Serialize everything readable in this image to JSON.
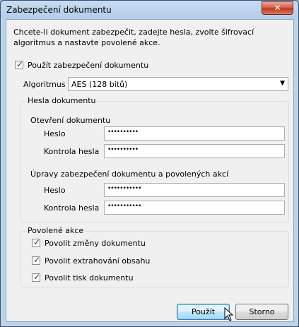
{
  "window": {
    "title": "Zabezpečení dokumentu",
    "close_glyph": "✕"
  },
  "description": "Chcete-li dokument zabezpečit, zadejte hesla, zvolte šifrovací algoritmus a nastavte povolené akce.",
  "use_security": {
    "label": "Použít zabezpečení dokumentu",
    "checked": true
  },
  "algorithm": {
    "label": "Algoritmus",
    "value": "AES (128 bitů)"
  },
  "passwords_group": {
    "title": "Hesla dokumentu",
    "open_section": {
      "title": "Otevření dokumentu",
      "password_label": "Heslo",
      "password_value": "••••••••••",
      "confirm_label": "Kontrola hesla",
      "confirm_value": "••••••••••"
    },
    "permissions_section": {
      "title": "Úpravy zabezpečení dokumentu a povolených akcí",
      "password_label": "Heslo",
      "password_value": "•••••••••••",
      "confirm_label": "Kontrola hesla",
      "confirm_value": "•••••••••••"
    }
  },
  "allowed_group": {
    "title": "Povolené akce",
    "items": [
      {
        "label": "Povolit změny dokumentu",
        "checked": true
      },
      {
        "label": "Povolit extrahování obsahu",
        "checked": true
      },
      {
        "label": "Povolit tisk dokumentu",
        "checked": true
      }
    ]
  },
  "buttons": {
    "ok": "Použít",
    "cancel": "Storno"
  }
}
